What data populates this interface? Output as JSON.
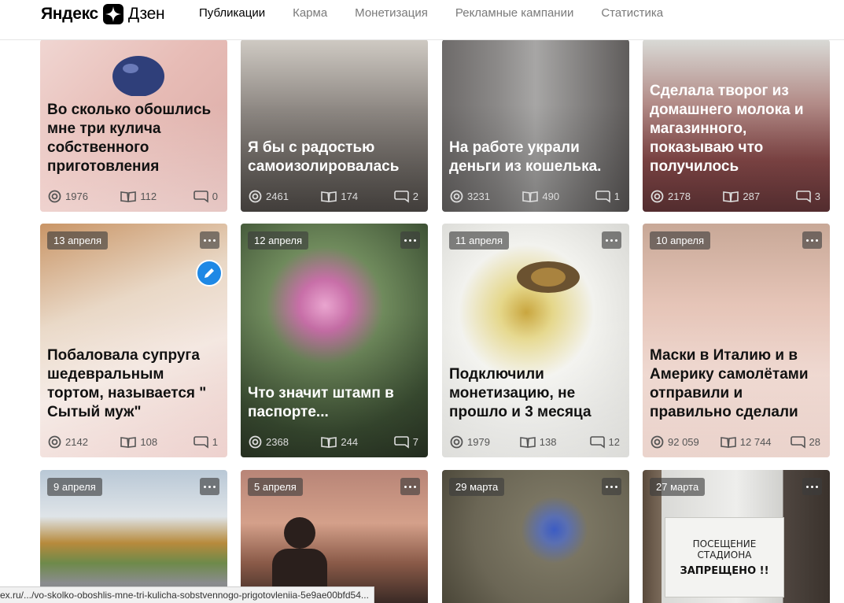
{
  "header": {
    "brand": "Яндекс",
    "product": "Дзен",
    "nav": [
      {
        "label": "Публикации",
        "active": true
      },
      {
        "label": "Карма",
        "active": false
      },
      {
        "label": "Монетизация",
        "active": false
      },
      {
        "label": "Рекламные кампании",
        "active": false
      },
      {
        "label": "Статистика",
        "active": false
      }
    ]
  },
  "cards": [
    {
      "title": "Во сколько обошлись мне три кулича собственного приготовления",
      "date": "",
      "views": "1976",
      "reads": "112",
      "comments": "0",
      "theme": "light",
      "bg": "#e9c8c4"
    },
    {
      "title": "Я бы с радостью самоизолировалась",
      "date": "",
      "views": "2461",
      "reads": "174",
      "comments": "2",
      "theme": "dark",
      "bg": "#7a7470"
    },
    {
      "title": "На работе украли деньги из кошелька.",
      "date": "",
      "views": "3231",
      "reads": "490",
      "comments": "1",
      "theme": "dark",
      "bg": "#6e6a6a"
    },
    {
      "title": "Сделала творог из домашнего молока и магазинного, показываю что получилось",
      "date": "",
      "views": "2178",
      "reads": "287",
      "comments": "3",
      "theme": "dark",
      "bg": "#8e5454"
    },
    {
      "title": "Побаловала супруга шедевральным тортом, называется \" Сытый муж\"",
      "date": "13 апреля",
      "views": "2142",
      "reads": "108",
      "comments": "1",
      "theme": "light",
      "bg": "#e8cdc2"
    },
    {
      "title": "Что значит штамп в паспорте...",
      "date": "12 апреля",
      "views": "2368",
      "reads": "244",
      "comments": "7",
      "theme": "dark",
      "bg": "#4e5d45"
    },
    {
      "title": "Подключили монетизацию, не прошло и 3 месяца",
      "date": "11 апреля",
      "views": "1979",
      "reads": "138",
      "comments": "12",
      "theme": "light",
      "bg": "#dcdcd6"
    },
    {
      "title": "Маски в Италию и в Америку самолётами отправили и правильно сделали",
      "date": "10 апреля",
      "views": "92 059",
      "reads": "12 744",
      "comments": "28",
      "theme": "light",
      "bg": "#e2c4b8"
    },
    {
      "title": "",
      "date": "9 апреля",
      "theme": "light",
      "bg": "#cfd6da"
    },
    {
      "title": "",
      "date": "5 апреля",
      "theme": "dark",
      "bg": "#6a4a3e"
    },
    {
      "title": "",
      "date": "29 марта",
      "theme": "dark",
      "bg": "#6f6a58"
    },
    {
      "title": "",
      "date": "27 марта",
      "theme": "dark",
      "bg": "#4a4540"
    }
  ],
  "photo_text": {
    "sign_line1": "ПОСЕЩЕНИЕ СТАДИОНА",
    "sign_line2": "ЗАПРЕЩЕНО !!"
  },
  "status_url": "ex.ru/.../vo-skolko-oboshlis-mne-tri-kulicha-sobstvennogo-prigotovleniia-5e9ae00bfd54..."
}
